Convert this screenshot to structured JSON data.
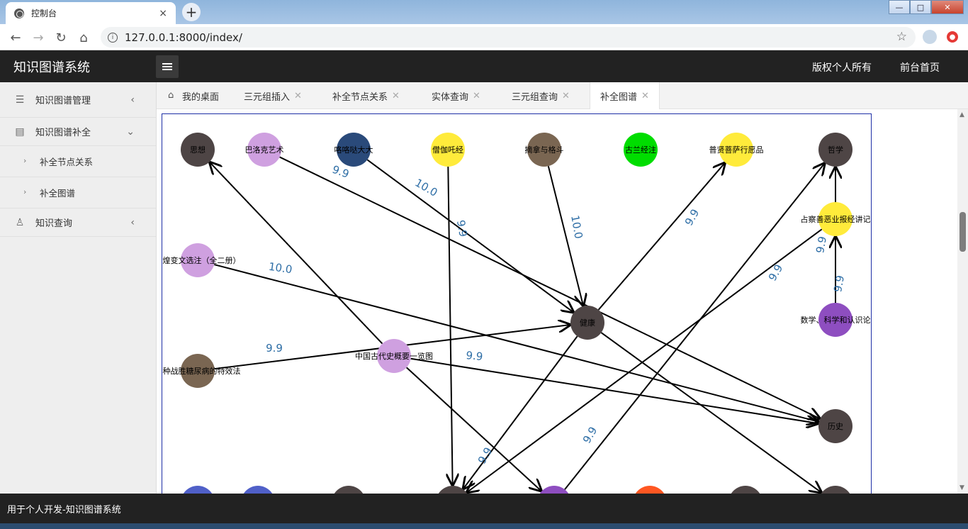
{
  "browser": {
    "tab_title": "控制台",
    "tab_close": "×",
    "new_tab": "+",
    "url": "127.0.0.1:8000/index/",
    "window_buttons": {
      "minimize": "—",
      "maximize": "□",
      "close": "✕"
    }
  },
  "header": {
    "brand": "知识图谱系统",
    "links": [
      "版权个人所有",
      "前台首页"
    ]
  },
  "sidebar": {
    "items": [
      {
        "label": "知识图谱管理",
        "icon": "list-icon",
        "chevron": "‹"
      },
      {
        "label": "知识图谱补全",
        "icon": "doc-icon",
        "chevron": "⌄"
      },
      {
        "label": "补全节点关系",
        "sub": true
      },
      {
        "label": "补全图谱",
        "sub": true
      },
      {
        "label": "知识查询",
        "icon": "user-icon",
        "chevron": "‹"
      }
    ]
  },
  "tabs": [
    {
      "label": "我的桌面",
      "home": true
    },
    {
      "label": "三元组插入"
    },
    {
      "label": "补全节点关系"
    },
    {
      "label": "实体查询"
    },
    {
      "label": "三元组查询"
    },
    {
      "label": "补全图谱",
      "active": true
    }
  ],
  "graph": {
    "nodes": [
      {
        "label": "思想",
        "color": "#4e4545"
      },
      {
        "label": "巴洛克艺术",
        "color": "#cfa0e0"
      },
      {
        "label": "咯咯哒大大",
        "color": "#2a4a7a"
      },
      {
        "label": "僧伽吒经",
        "color": "#ffeb3b"
      },
      {
        "label": "摘拿与格斗",
        "color": "#7a6652"
      },
      {
        "label": "古兰经注",
        "color": "#00dd00"
      },
      {
        "label": "普贤菩萨行愿品",
        "color": "#ffeb3b"
      },
      {
        "label": "哲学",
        "color": "#4e4545"
      },
      {
        "label": "占察善恶业报经讲记",
        "color": "#ffeb3b"
      },
      {
        "label": "敦煌变文选注（全二册）",
        "color": "#cfa0e0"
      },
      {
        "label": "数学、科学和认识论",
        "color": "#8e4ec0"
      },
      {
        "label": "健康",
        "color": "#4e4545"
      },
      {
        "label": "中国古代史概要一览图",
        "color": "#cfa0e0"
      },
      {
        "label": "一种战胜糖尿病的特效法",
        "color": "#7a6652"
      },
      {
        "label": "历史",
        "color": "#4e4545"
      },
      {
        "label": "",
        "color": "#5060c8"
      },
      {
        "label": "",
        "color": "#5060c8"
      },
      {
        "label": "",
        "color": "#4e4545"
      },
      {
        "label": "",
        "color": "#4e4545"
      },
      {
        "label": "",
        "color": "#8e4ec0"
      },
      {
        "label": "",
        "color": "#ff5722"
      },
      {
        "label": "",
        "color": "#4e4545"
      },
      {
        "label": "",
        "color": "#4e4545"
      }
    ],
    "edge_labels": [
      "9.9",
      "10.0",
      "9.9",
      "10.0",
      "9.9",
      "9.9",
      "9.9",
      "10.0",
      "9.9",
      "9.9",
      "9.9",
      "9.9",
      "9.9",
      "9.9"
    ]
  },
  "footer": {
    "text": "用于个人开发-知识图谱系统"
  }
}
